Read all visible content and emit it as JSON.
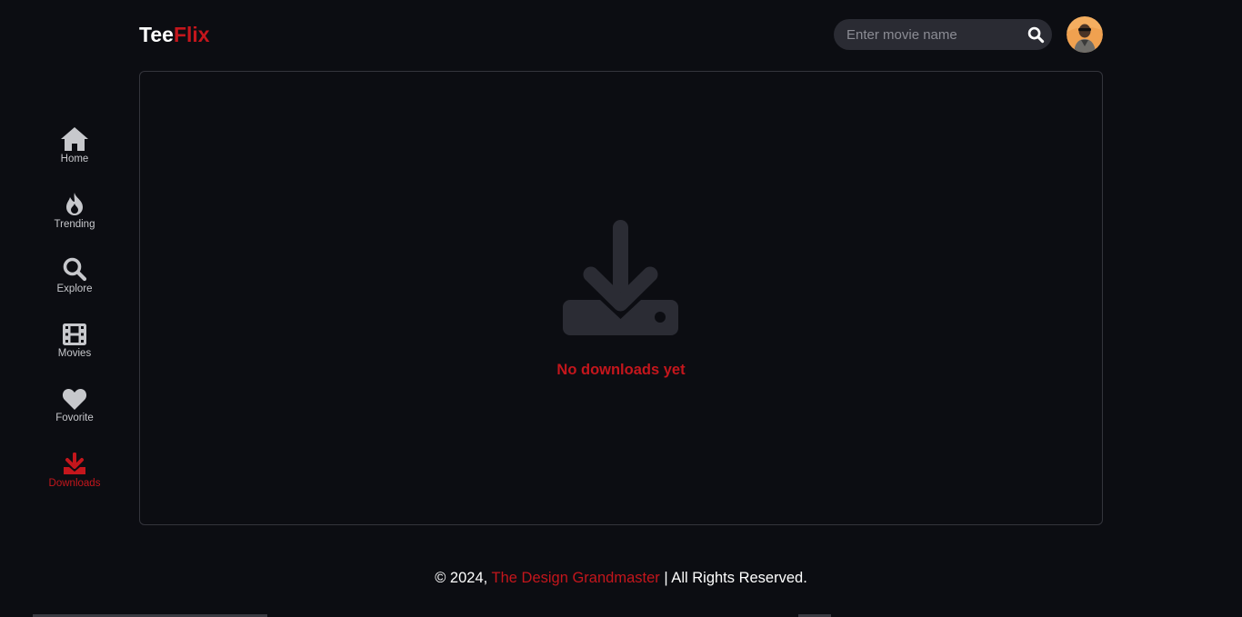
{
  "header": {
    "logo_part1": "Tee",
    "logo_part2": "Flix",
    "search_placeholder": "Enter movie name",
    "search_icon": "search-icon"
  },
  "sidebar": {
    "items": [
      {
        "label": "Home",
        "icon": "home-icon"
      },
      {
        "label": "Trending",
        "icon": "fire-icon"
      },
      {
        "label": "Explore",
        "icon": "search-icon"
      },
      {
        "label": "Movies",
        "icon": "film-icon"
      },
      {
        "label": "Fovorite",
        "icon": "heart-icon"
      },
      {
        "label": "Downloads",
        "icon": "download-icon",
        "active": true
      }
    ]
  },
  "main": {
    "empty_icon": "download-tray-icon",
    "empty_text": "No downloads yet"
  },
  "footer": {
    "prefix": "© 2024, ",
    "brand": "The Design Grandmaster",
    "suffix": " | All Rights Reserved."
  },
  "colors": {
    "background": "#0c0d12",
    "accent": "#c4161c",
    "muted_icon": "#2b2c34",
    "nav_text": "#c7c8cc"
  }
}
